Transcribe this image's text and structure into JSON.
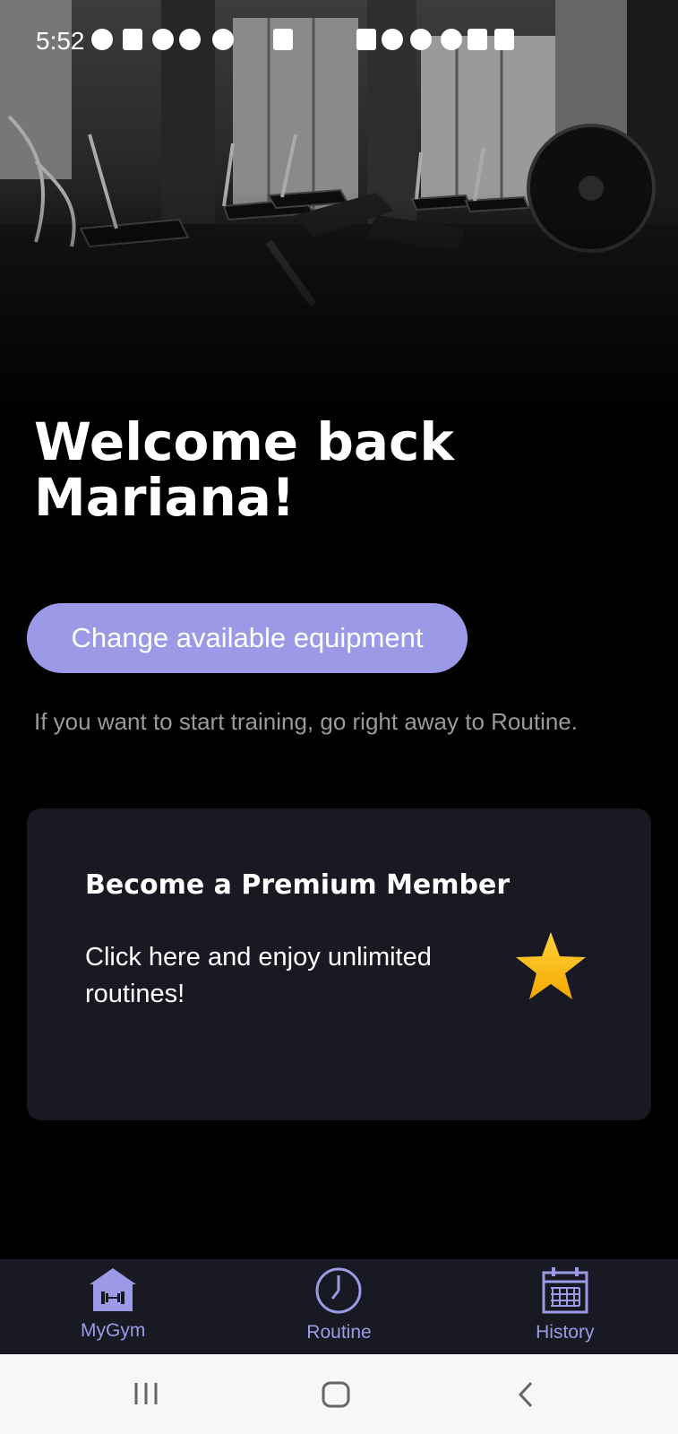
{
  "status_bar": {
    "time": "5:52"
  },
  "home": {
    "greeting_line1": "Welcome back",
    "greeting_line2": "Mariana!",
    "equipment_button": "Change available equipment",
    "hint": "If you want to start training, go right away to Routine."
  },
  "premium": {
    "title": "Become a Premium Member",
    "description": "Click here and enjoy unlimited routines!",
    "icon": "star-icon"
  },
  "bottom_nav": {
    "items": [
      {
        "label": "MyGym",
        "icon": "gym-home-icon",
        "active": true
      },
      {
        "label": "Routine",
        "icon": "clock-icon",
        "active": false
      },
      {
        "label": "History",
        "icon": "calendar-icon",
        "active": false
      }
    ]
  },
  "system_nav": {
    "buttons": [
      "recent-apps-icon",
      "home-icon",
      "back-icon"
    ]
  },
  "colors": {
    "accent": "#9a9ae6",
    "card": "#191923",
    "background": "#000000",
    "star": "#f5b800"
  }
}
